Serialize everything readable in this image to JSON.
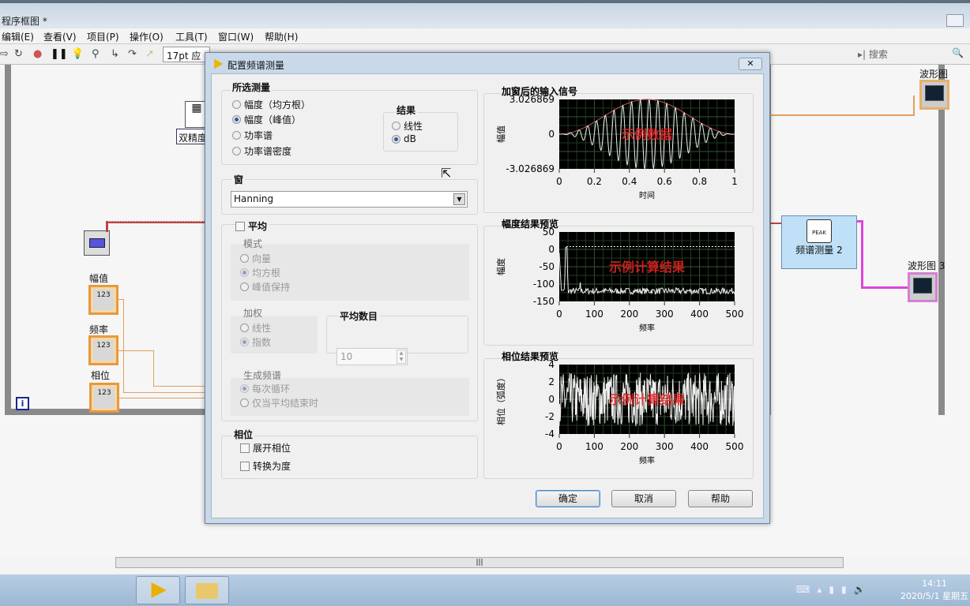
{
  "window": {
    "title": "程序框图 *"
  },
  "menu": [
    "编辑(E)",
    "查看(V)",
    "项目(P)",
    "操作(O)",
    "工具(T)",
    "窗口(W)",
    "帮助(H)"
  ],
  "toolbar": {
    "font": "17pt 应用",
    "search_placeholder": "搜索"
  },
  "diagram": {
    "node_label_partial": "双精度",
    "controls": [
      {
        "label": "幅值",
        "type": "DBL"
      },
      {
        "label": "频率",
        "type": "DBL"
      },
      {
        "label": "相位",
        "type": "DBL"
      }
    ],
    "graph1": "波形图",
    "graph3": "波形图 3",
    "express_vi": "频谱测量 2",
    "express_vi_icon": "PEAK",
    "loop_index": "i",
    "numeric": "123"
  },
  "dialog": {
    "title": "配置频谱测量",
    "close": "✕",
    "measurement": {
      "title": "所选测量",
      "options": [
        "幅度（均方根）",
        "幅度（峰值）",
        "功率谱",
        "功率谱密度"
      ],
      "selected": 1
    },
    "result": {
      "title": "结果",
      "options": [
        "线性",
        "dB"
      ],
      "selected": 1
    },
    "window": {
      "title": "窗",
      "value": "Hanning"
    },
    "averaging": {
      "title": "平均",
      "checked": false,
      "mode": {
        "title": "模式",
        "options": [
          "向量",
          "均方根",
          "峰值保持"
        ],
        "selected": 1
      },
      "weighting": {
        "title": "加权",
        "options": [
          "线性",
          "指数"
        ],
        "selected": 1
      },
      "count": {
        "title": "平均数目",
        "value": "10"
      },
      "spectrum": {
        "title": "生成频谱",
        "options": [
          "每次循环",
          "仅当平均结束时"
        ],
        "selected": 0
      }
    },
    "phase": {
      "title": "相位",
      "unwrap": "展开相位",
      "to_degrees": "转换为度"
    },
    "buttons": {
      "ok": "确定",
      "cancel": "取消",
      "help": "帮助"
    }
  },
  "chart_data": [
    {
      "type": "line",
      "title": "加窗后的输入信号",
      "xlabel": "时间",
      "ylabel": "幅值",
      "xlim": [
        0,
        1
      ],
      "ylim": [
        -3.026869,
        3.026869
      ],
      "xticks": [
        "0",
        "0.2",
        "0.4",
        "0.6",
        "0.8",
        "1"
      ],
      "yticks": [
        "3.026869",
        "0",
        "-3.026869"
      ],
      "watermark": "示例数据",
      "signal": {
        "amplitude": 3.026869,
        "cycles": 20,
        "window": "Hanning"
      }
    },
    {
      "type": "line",
      "title": "幅度结果预览",
      "xlabel": "频率",
      "ylabel": "幅度",
      "xlim": [
        0,
        500
      ],
      "ylim": [
        -150,
        50
      ],
      "xticks": [
        "0",
        "100",
        "200",
        "300",
        "400",
        "500"
      ],
      "yticks": [
        "50",
        "0",
        "-50",
        "-100",
        "-150"
      ],
      "watermark": "示例计算结果",
      "peak": {
        "x": 20,
        "y": 5
      },
      "noise_floor": -120,
      "marker_line": 8
    },
    {
      "type": "line",
      "title": "相位结果预览",
      "xlabel": "频率",
      "ylabel": "相位（弧度）",
      "xlim": [
        0,
        500
      ],
      "ylim": [
        -4,
        4
      ],
      "xticks": [
        "0",
        "100",
        "200",
        "300",
        "400",
        "500"
      ],
      "yticks": [
        "4",
        "2",
        "0",
        "-2",
        "-4"
      ],
      "watermark": "示例计算结果",
      "range": [
        -3.14,
        3.14
      ]
    }
  ],
  "taskbar": {
    "time": "14:11",
    "date": "2020/5/1 星期五"
  }
}
